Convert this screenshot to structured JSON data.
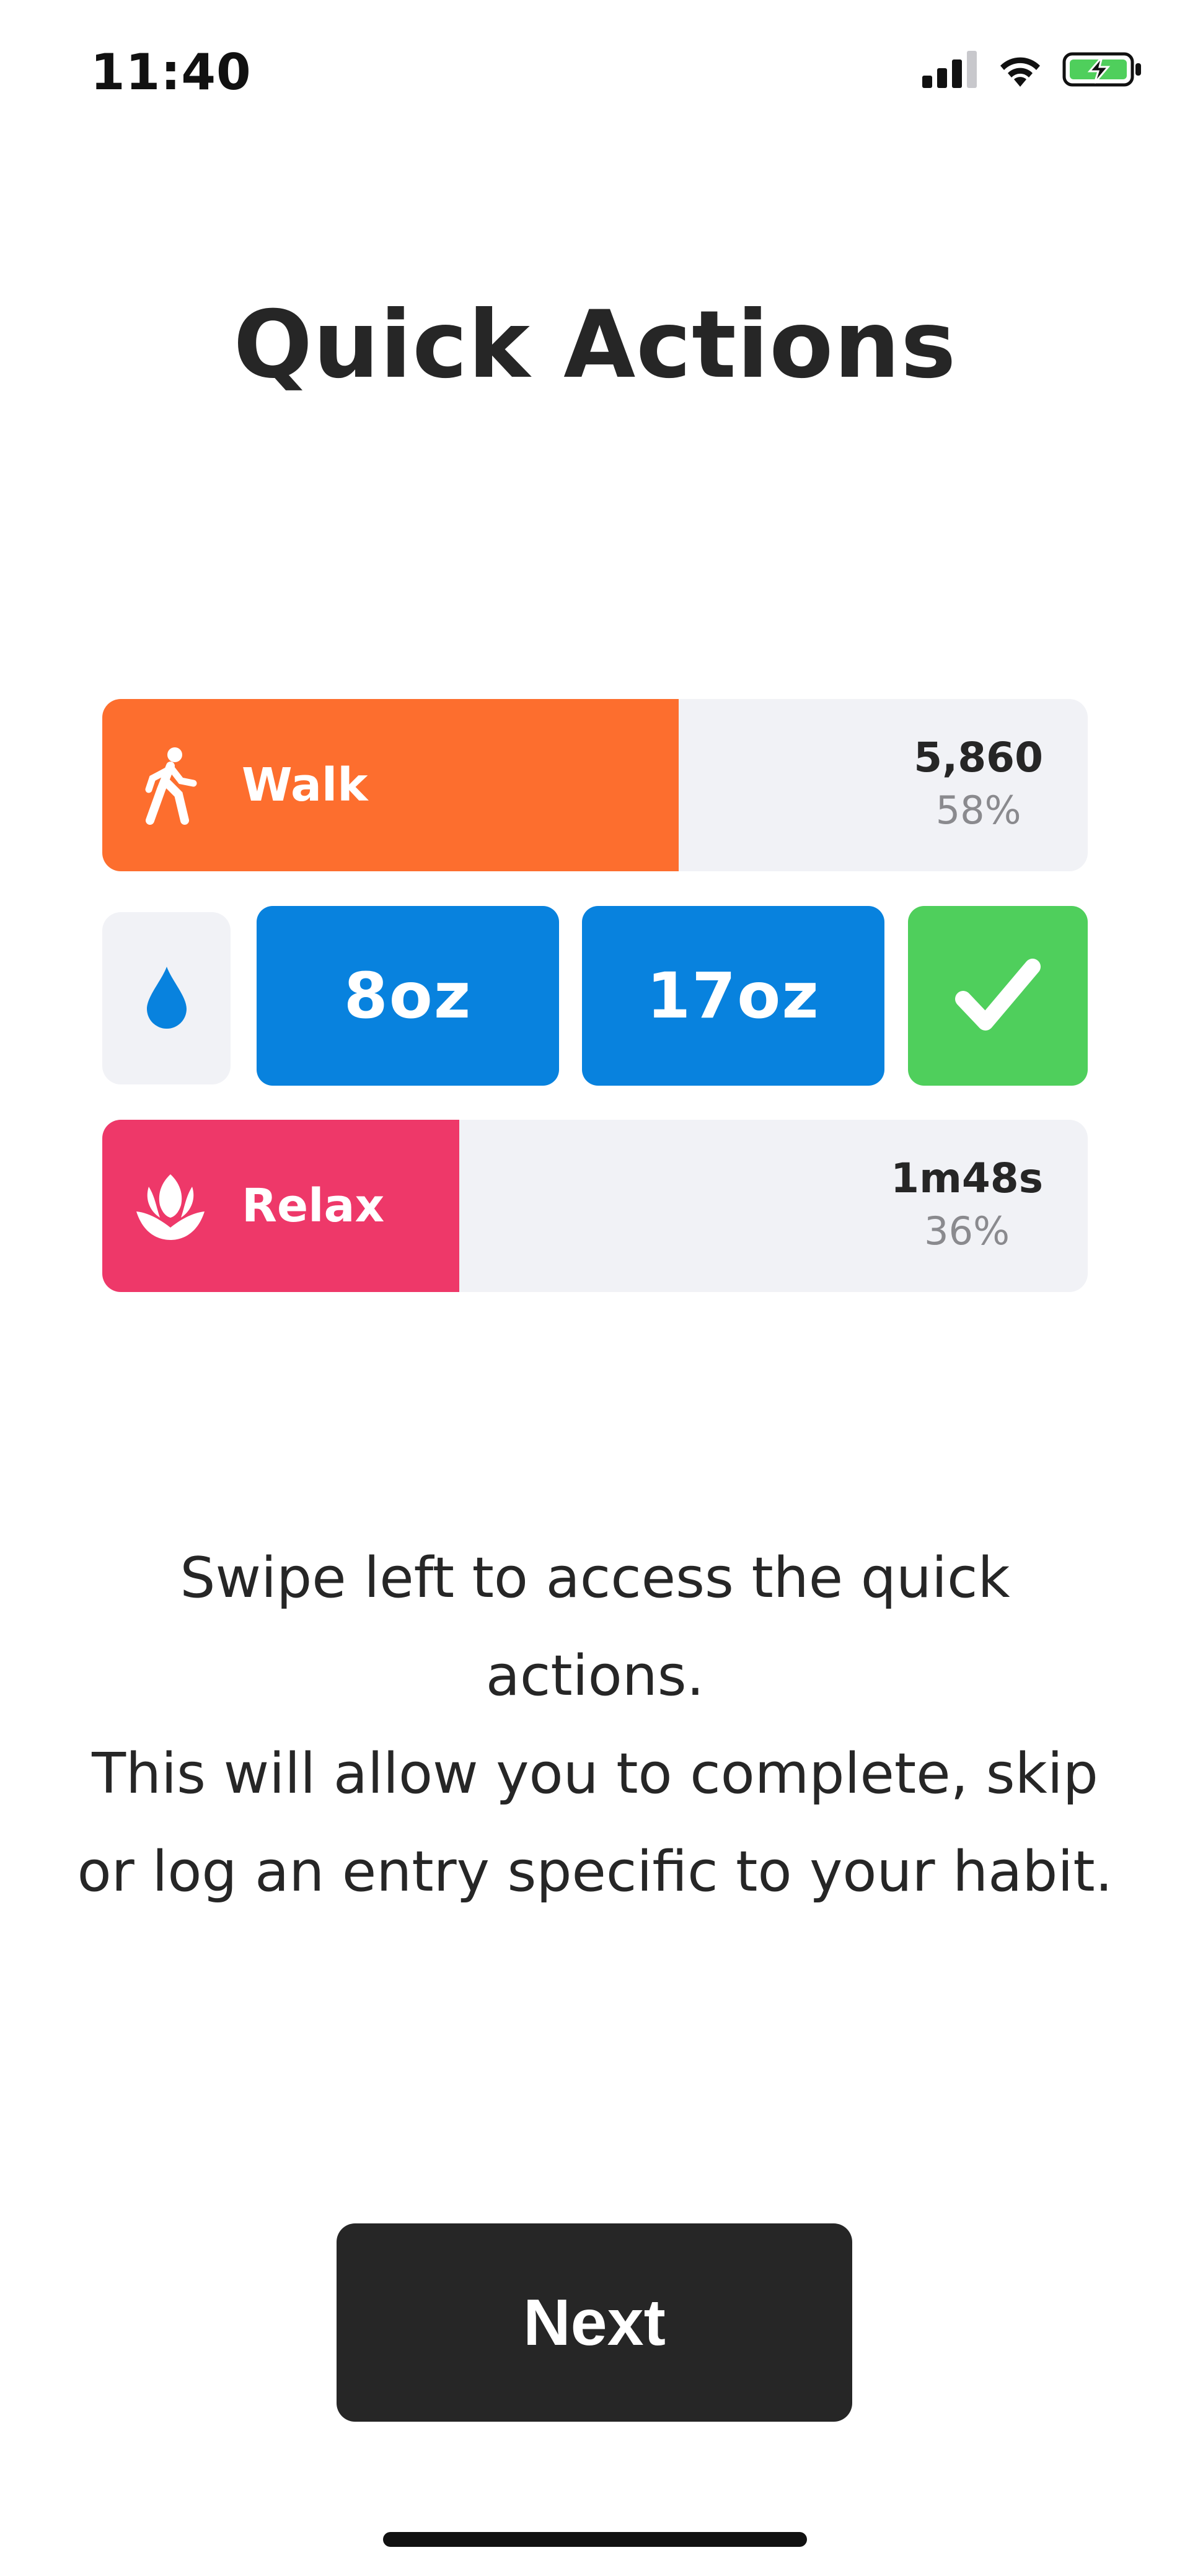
{
  "status_bar": {
    "time": "11:40",
    "icons": [
      "cellular-signal-icon",
      "wifi-icon",
      "battery-charging-icon"
    ]
  },
  "title": "Quick Actions",
  "rows": {
    "walk": {
      "label": "Walk",
      "icon": "walking-person-icon",
      "value": "5,860",
      "percent_text": "58%",
      "progress": 0.585,
      "color": "#fd6e2e"
    },
    "water": {
      "icon": "water-drop-icon",
      "buttons": [
        "8oz",
        "17oz"
      ],
      "button_color": "#0882de",
      "complete_icon": "checkmark-icon",
      "complete_color": "#4fcf5c"
    },
    "relax": {
      "label": "Relax",
      "icon": "lotus-flower-icon",
      "value": "1m48s",
      "percent_text": "36%",
      "progress": 0.362,
      "color": "#ee3869"
    }
  },
  "description": [
    "Swipe left to access the quick actions.",
    "This will allow you to complete, skip",
    "or log an entry specific to your habit."
  ],
  "next_button": "Next"
}
